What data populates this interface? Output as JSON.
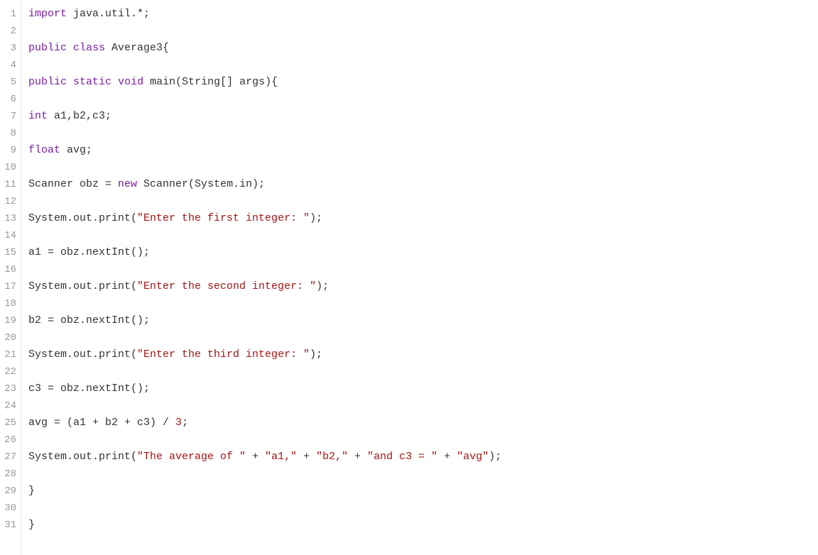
{
  "lines": [
    {
      "num": "1",
      "tokens": [
        {
          "t": "import",
          "c": "kw"
        },
        {
          "t": " java.util.*;",
          "c": ""
        }
      ]
    },
    {
      "num": "2",
      "tokens": []
    },
    {
      "num": "3",
      "tokens": [
        {
          "t": "public",
          "c": "kw"
        },
        {
          "t": " ",
          "c": ""
        },
        {
          "t": "class",
          "c": "kw"
        },
        {
          "t": " Average3{",
          "c": ""
        }
      ]
    },
    {
      "num": "4",
      "tokens": []
    },
    {
      "num": "5",
      "tokens": [
        {
          "t": "public",
          "c": "kw"
        },
        {
          "t": " ",
          "c": ""
        },
        {
          "t": "static",
          "c": "kw"
        },
        {
          "t": " ",
          "c": ""
        },
        {
          "t": "void",
          "c": "kw"
        },
        {
          "t": " main(String[] args){",
          "c": ""
        }
      ]
    },
    {
      "num": "6",
      "tokens": []
    },
    {
      "num": "7",
      "tokens": [
        {
          "t": "int",
          "c": "kw"
        },
        {
          "t": " a1,b2,c3;",
          "c": ""
        }
      ]
    },
    {
      "num": "8",
      "tokens": []
    },
    {
      "num": "9",
      "tokens": [
        {
          "t": "float",
          "c": "kw"
        },
        {
          "t": " avg;",
          "c": ""
        }
      ]
    },
    {
      "num": "10",
      "tokens": []
    },
    {
      "num": "11",
      "tokens": [
        {
          "t": "Scanner obz = ",
          "c": ""
        },
        {
          "t": "new",
          "c": "kw"
        },
        {
          "t": " Scanner(System.in);",
          "c": ""
        }
      ]
    },
    {
      "num": "12",
      "tokens": []
    },
    {
      "num": "13",
      "tokens": [
        {
          "t": "System.out.print(",
          "c": ""
        },
        {
          "t": "\"Enter the first integer: \"",
          "c": "str"
        },
        {
          "t": ");",
          "c": ""
        }
      ]
    },
    {
      "num": "14",
      "tokens": []
    },
    {
      "num": "15",
      "tokens": [
        {
          "t": "a1 = obz.nextInt();",
          "c": ""
        }
      ]
    },
    {
      "num": "16",
      "tokens": []
    },
    {
      "num": "17",
      "tokens": [
        {
          "t": "System.out.print(",
          "c": ""
        },
        {
          "t": "\"Enter the second integer: \"",
          "c": "str"
        },
        {
          "t": ");",
          "c": ""
        }
      ]
    },
    {
      "num": "18",
      "tokens": []
    },
    {
      "num": "19",
      "tokens": [
        {
          "t": "b2 = obz.nextInt();",
          "c": ""
        }
      ]
    },
    {
      "num": "20",
      "tokens": []
    },
    {
      "num": "21",
      "tokens": [
        {
          "t": "System.out.print(",
          "c": ""
        },
        {
          "t": "\"Enter the third integer: \"",
          "c": "str"
        },
        {
          "t": ");",
          "c": ""
        }
      ]
    },
    {
      "num": "22",
      "tokens": []
    },
    {
      "num": "23",
      "tokens": [
        {
          "t": "c3 = obz.nextInt();",
          "c": ""
        }
      ]
    },
    {
      "num": "24",
      "tokens": []
    },
    {
      "num": "25",
      "tokens": [
        {
          "t": "avg = (a1 + b2 + c3) / ",
          "c": ""
        },
        {
          "t": "3",
          "c": "num"
        },
        {
          "t": ";",
          "c": ""
        }
      ]
    },
    {
      "num": "26",
      "tokens": []
    },
    {
      "num": "27",
      "tokens": [
        {
          "t": "System.out.print(",
          "c": ""
        },
        {
          "t": "\"The average of \"",
          "c": "str"
        },
        {
          "t": " + ",
          "c": ""
        },
        {
          "t": "\"a1,\"",
          "c": "str"
        },
        {
          "t": " + ",
          "c": ""
        },
        {
          "t": "\"b2,\"",
          "c": "str"
        },
        {
          "t": " + ",
          "c": ""
        },
        {
          "t": "\"and c3 = \"",
          "c": "str"
        },
        {
          "t": " + ",
          "c": ""
        },
        {
          "t": "\"avg\"",
          "c": "str"
        },
        {
          "t": ");",
          "c": ""
        }
      ]
    },
    {
      "num": "28",
      "tokens": []
    },
    {
      "num": "29",
      "tokens": [
        {
          "t": "}",
          "c": ""
        }
      ]
    },
    {
      "num": "30",
      "tokens": []
    },
    {
      "num": "31",
      "tokens": [
        {
          "t": "}",
          "c": ""
        }
      ]
    }
  ]
}
